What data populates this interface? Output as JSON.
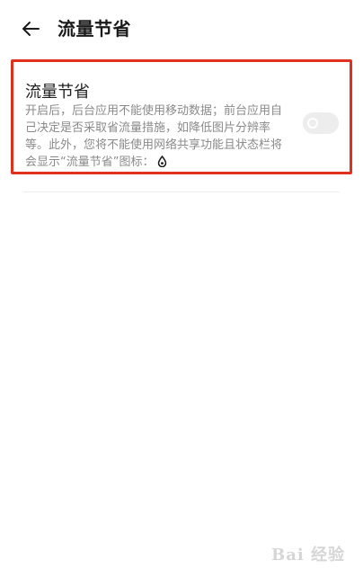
{
  "header": {
    "back_icon": "arrow-left-icon",
    "title": "流量节省"
  },
  "setting": {
    "title": "流量节省",
    "description": "开启后，后台应用不能使用移动数据；前台应用自己决定是否采取省流量措施，如降低图片分辨率等。此外，您将不能使用网络共享功能且状态栏将会显示“流量节省”图标：",
    "status_icon": "data-saver-drop-icon",
    "toggle_on": false
  },
  "watermark": {
    "text": "Bai 经验",
    "icon": "paw-icon"
  },
  "colors": {
    "highlight_border": "#e2301f",
    "title_text": "#1f1f1f",
    "description_text": "#8a8a8a",
    "toggle_track": "#ededed"
  }
}
